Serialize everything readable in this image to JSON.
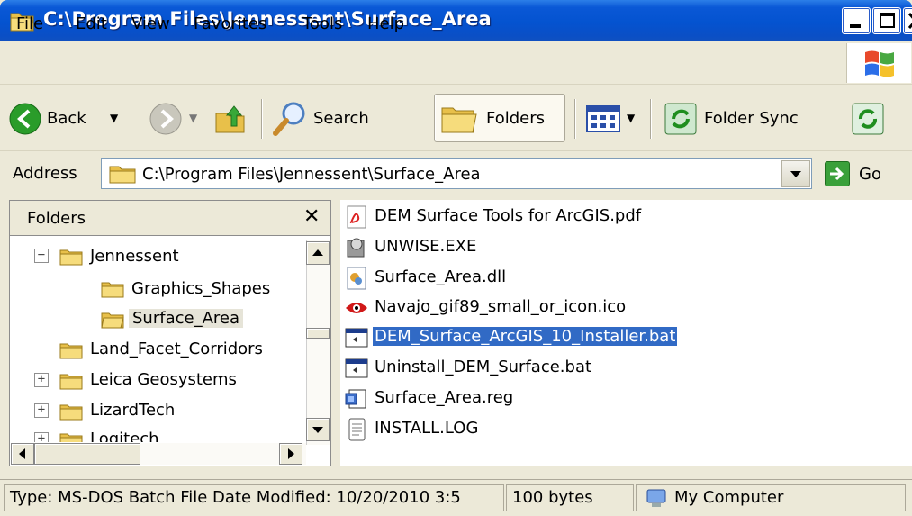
{
  "window": {
    "title": "C:\\Program Files\\Jennessent\\Surface_Area"
  },
  "menu": [
    {
      "label": "File"
    },
    {
      "label": "Edit"
    },
    {
      "label": "View"
    },
    {
      "label": "Favorites"
    },
    {
      "label": "Tools"
    },
    {
      "label": "Help"
    }
  ],
  "toolbar": {
    "back_label": "Back",
    "search_label": "Search",
    "folders_label": "Folders",
    "folder_sync_label": "Folder Sync"
  },
  "address": {
    "label": "Address",
    "value": "C:\\Program Files\\Jennessent\\Surface_Area",
    "go_label": "Go"
  },
  "folders_pane": {
    "title": "Folders",
    "close_glyph": "✕",
    "tree": [
      {
        "label": "Jennessent",
        "expander": "−"
      },
      {
        "label": "Graphics_Shapes"
      },
      {
        "label": "Surface_Area"
      },
      {
        "label": "Land_Facet_Corridors"
      },
      {
        "label": "Leica Geosystems",
        "expander": "+"
      },
      {
        "label": "LizardTech",
        "expander": "+"
      },
      {
        "label": "Logitech",
        "expander": "+"
      }
    ]
  },
  "files": [
    {
      "name": "DEM Surface Tools for ArcGIS.pdf",
      "icon": "pdf-icon"
    },
    {
      "name": "UNWISE.EXE",
      "icon": "installer-exe-icon"
    },
    {
      "name": "Surface_Area.dll",
      "icon": "dll-icon"
    },
    {
      "name": "Navajo_gif89_small_or_icon.ico",
      "icon": "eye-icon"
    },
    {
      "name": "DEM_Surface_ArcGIS_10_Installer.bat",
      "icon": "batch-file-icon"
    },
    {
      "name": "Uninstall_DEM_Surface.bat",
      "icon": "batch-file-icon"
    },
    {
      "name": "Surface_Area.reg",
      "icon": "registry-file-icon"
    },
    {
      "name": "INSTALL.LOG",
      "icon": "text-file-icon"
    }
  ],
  "status": {
    "type_info": "Type: MS-DOS Batch File Date Modified: 10/20/2010 3:5",
    "size": "100 bytes",
    "location": "My Computer"
  },
  "colors": {
    "titlebar": "#0453d0",
    "selection": "#316ac5",
    "chrome": "#ece9d8"
  }
}
